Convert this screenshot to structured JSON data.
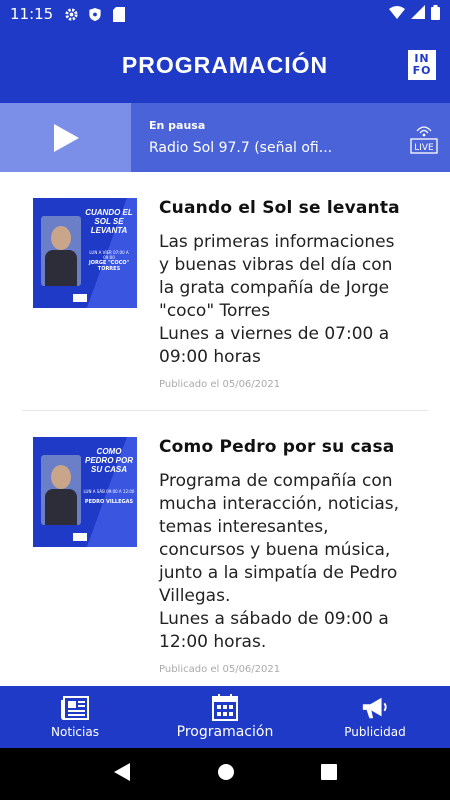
{
  "status_bar": {
    "time": "11:15",
    "left_icons": [
      "gear-icon",
      "shield-icon",
      "sd-card-icon"
    ],
    "right_icons": [
      "wifi-icon",
      "signal-icon",
      "battery-icon"
    ]
  },
  "app_bar": {
    "title": "PROGRAMACIÓN",
    "info_top": "IN",
    "info_bottom": "FO"
  },
  "player": {
    "status": "En pausa",
    "station": "Radio Sol 97.7 (señal ofi...",
    "live_label": "LIVE"
  },
  "programs": [
    {
      "title": "Cuando el Sol se levanta",
      "description": "Las primeras informaciones\ny buenas vibras del día con\nla grata compañía de Jorge\n\"coco\" Torres\nLunes a viernes de 07:00 a\n09:00 horas",
      "date": "Publicado el 05/06/2021",
      "thumb_title": "CUANDO EL SOL SE LEVANTA",
      "thumb_sub": "LUN A VIER 07:00 A 09:00",
      "thumb_name": "JORGE \"COCO\" TORRES"
    },
    {
      "title": "Como Pedro por su casa",
      "description": "Programa de compañía con\nmucha interacción, noticias,\ntemas interesantes,\nconcursos y buena música,\njunto a la simpatía de Pedro\nVillegas.\nLunes a sábado de 09:00 a\n12:00 horas.",
      "date": "Publicado el 05/06/2021",
      "thumb_title": "COMO PEDRO POR SU CASA",
      "thumb_sub": "LUN A SÁB 09:00 A 12:00",
      "thumb_name": "PEDRO VILLEGAS"
    }
  ],
  "bottom_nav": [
    {
      "label": "Noticias",
      "icon": "newspaper-icon"
    },
    {
      "label": "Programación",
      "icon": "calendar-icon"
    },
    {
      "label": "Publicidad",
      "icon": "megaphone-icon"
    }
  ],
  "colors": {
    "primary": "#1f3ac7",
    "player_bg": "#4b63d9",
    "play_box": "#7b8ee8"
  }
}
